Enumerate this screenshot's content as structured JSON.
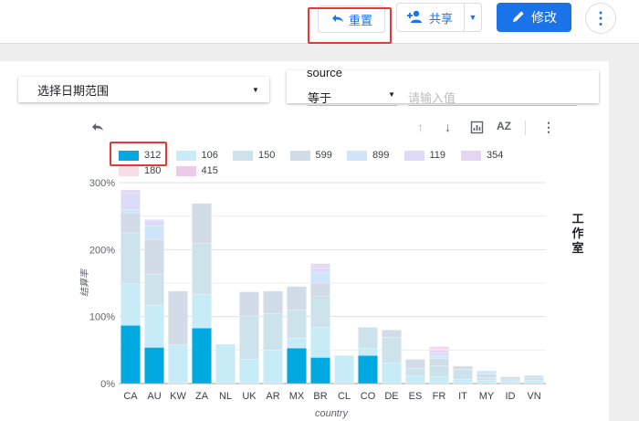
{
  "toolbar": {
    "reset_label": "重置",
    "share_label": "共享",
    "edit_label": "修改"
  },
  "controls": {
    "date_range_label": "选择日期范围",
    "filter_title": "source",
    "operator": "等于",
    "value_placeholder": "请输入值"
  },
  "side_label": "工作室",
  "colors": {
    "s312": "#00a9e0",
    "s106": "#c7ebf7",
    "s150": "#cde3ec",
    "s599": "#d2dbe8",
    "s899": "#cfe5f9",
    "s119": "#dcdcf8",
    "s354": "#e2d6f3",
    "s180": "#f6dde7",
    "s415": "#eccaea",
    "accent": "#1a73e8",
    "highlight_box": "#e53935"
  },
  "chart_data": {
    "type": "bar",
    "stacked": true,
    "categories": [
      "CA",
      "AU",
      "KW",
      "ZA",
      "NL",
      "UK",
      "AR",
      "MX",
      "BR",
      "CL",
      "CO",
      "DE",
      "ES",
      "FR",
      "IT",
      "MY",
      "ID",
      "VN"
    ],
    "xlabel": "country",
    "ylabel": "结算率",
    "ylim": [
      0,
      300
    ],
    "y_unit": "%",
    "yticks": [
      0,
      100,
      200,
      300
    ],
    "grid": true,
    "legend_position": "top-left",
    "series": [
      {
        "name": "312",
        "values": [
          87,
          54,
          0,
          83,
          0,
          0,
          0,
          53,
          39,
          0,
          42,
          0,
          0,
          0,
          0,
          0,
          0,
          0
        ]
      },
      {
        "name": "106",
        "values": [
          62,
          63,
          58,
          50,
          59,
          36,
          50,
          15,
          45,
          42,
          10,
          31,
          11,
          10,
          6,
          5,
          4,
          5
        ]
      },
      {
        "name": "150",
        "values": [
          76,
          46,
          0,
          76,
          0,
          65,
          54,
          42,
          46,
          0,
          32,
          38,
          12,
          17,
          15,
          4,
          3,
          4
        ]
      },
      {
        "name": "599",
        "values": [
          30,
          52,
          80,
          60,
          0,
          36,
          34,
          35,
          20,
          0,
          0,
          11,
          13,
          10,
          5,
          5,
          3,
          3
        ]
      },
      {
        "name": "899",
        "values": [
          5,
          20,
          0,
          0,
          0,
          0,
          0,
          0,
          15,
          0,
          0,
          0,
          0,
          4,
          0,
          5,
          0,
          0
        ]
      },
      {
        "name": "119",
        "values": [
          25,
          8,
          0,
          0,
          0,
          0,
          0,
          0,
          8,
          0,
          0,
          0,
          0,
          5,
          0,
          0,
          0,
          0
        ]
      },
      {
        "name": "354",
        "values": [
          4,
          2,
          0,
          0,
          0,
          0,
          0,
          0,
          4,
          0,
          0,
          0,
          0,
          4,
          0,
          0,
          0,
          0
        ]
      },
      {
        "name": "180",
        "values": [
          0,
          0,
          0,
          0,
          0,
          0,
          0,
          0,
          0,
          0,
          0,
          0,
          0,
          3,
          0,
          0,
          0,
          0
        ]
      },
      {
        "name": "415",
        "values": [
          0,
          0,
          0,
          0,
          0,
          0,
          0,
          0,
          2,
          0,
          0,
          0,
          0,
          2,
          0,
          0,
          0,
          0
        ]
      }
    ]
  }
}
